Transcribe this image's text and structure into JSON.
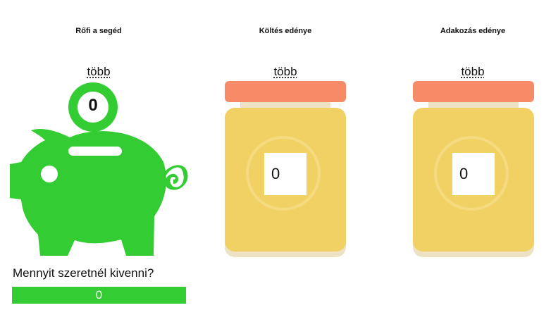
{
  "columns": {
    "piggy": {
      "title": "Rőfi a segéd",
      "more_label": "több",
      "coin_value": "0"
    },
    "spend": {
      "title": "Költés edénye",
      "more_label": "több",
      "value": "0"
    },
    "donate": {
      "title": "Adakozás edénye",
      "more_label": "több",
      "value": "0"
    }
  },
  "withdraw": {
    "prompt": "Mennyit szeretnél kivenni?",
    "value": "0"
  },
  "colors": {
    "piggy_green": "#33cc33",
    "jar_lid": "#f78a67",
    "jar_body": "#f2d164",
    "jar_shadow": "#ede3c4"
  },
  "icons": {
    "piggy": "piggy-bank-icon",
    "coin": "coin-icon"
  }
}
